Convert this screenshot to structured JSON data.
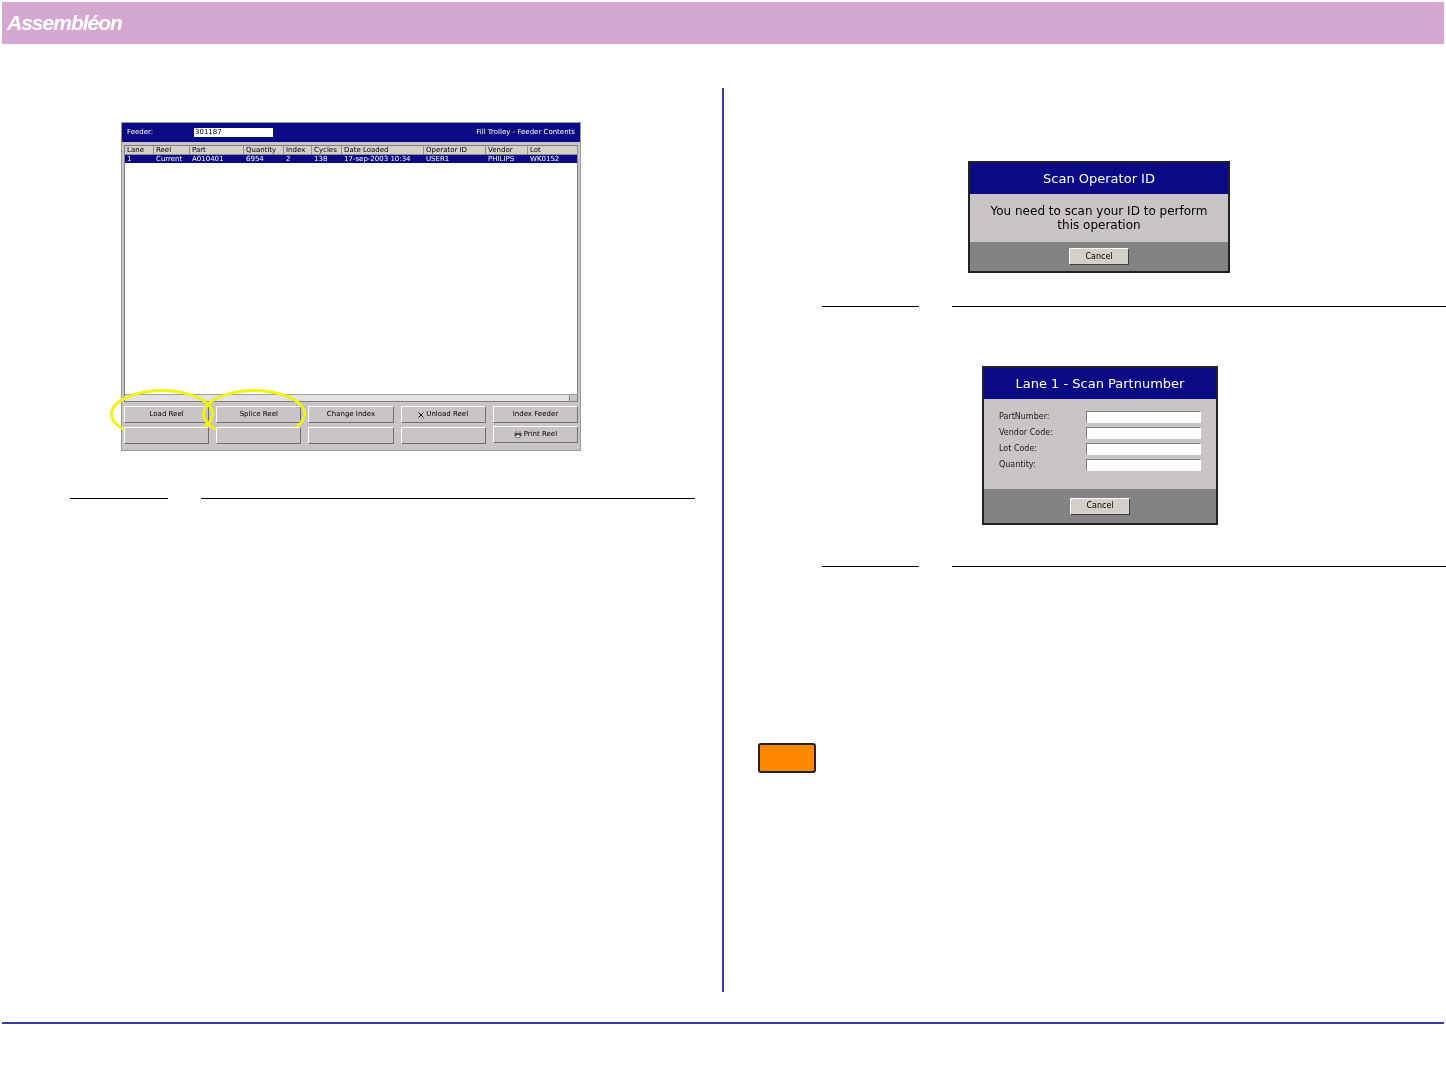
{
  "header": {
    "logo": "Assembléon"
  },
  "feeder_window": {
    "feeder_label": "Feeder:",
    "feeder_value": "301187",
    "title": "Fill Trolley - Feeder Contents",
    "columns": [
      "Lane",
      "Reel",
      "Part",
      "Quantity",
      "Index",
      "Cycles",
      "Date Loaded",
      "Operator ID",
      "Vendor",
      "Lot"
    ],
    "rows": [
      {
        "selected": true,
        "cells": [
          "1",
          "Current",
          "A010401",
          "6954",
          "2",
          "138",
          "17-sep-2003 10:34",
          "USER1",
          "PHILIPS",
          "WK0152"
        ]
      }
    ],
    "buttons": [
      {
        "kind": "label",
        "label": "Load Reel",
        "highlighted": true
      },
      {
        "kind": "label",
        "label": "Splice Reel",
        "highlighted": true
      },
      {
        "kind": "label",
        "label": "Change Index",
        "highlighted": false
      },
      {
        "kind": "cross_label",
        "label": "Unload Reel",
        "highlighted": false
      },
      {
        "kind": "label",
        "label": "Index Feeder",
        "highlighted": false
      },
      {
        "kind": "blank",
        "highlighted": false
      },
      {
        "kind": "blank",
        "highlighted": false
      },
      {
        "kind": "blank",
        "highlighted": false
      },
      {
        "kind": "blank",
        "highlighted": false
      },
      {
        "kind": "printer_label",
        "label": "Print Reel",
        "highlighted": false
      }
    ]
  },
  "scan_operator_dialog": {
    "title": "Scan Operator ID",
    "message": "You need to scan your ID to perform this operation",
    "button": "Cancel"
  },
  "scan_part_dialog": {
    "title": "Lane 1 - Scan Partnumber",
    "fields": [
      {
        "label": "PartNumber:"
      },
      {
        "label": "Vendor Code:"
      },
      {
        "label": "Lot Code:"
      },
      {
        "label": "Quantity:"
      }
    ],
    "button": "Cancel"
  }
}
